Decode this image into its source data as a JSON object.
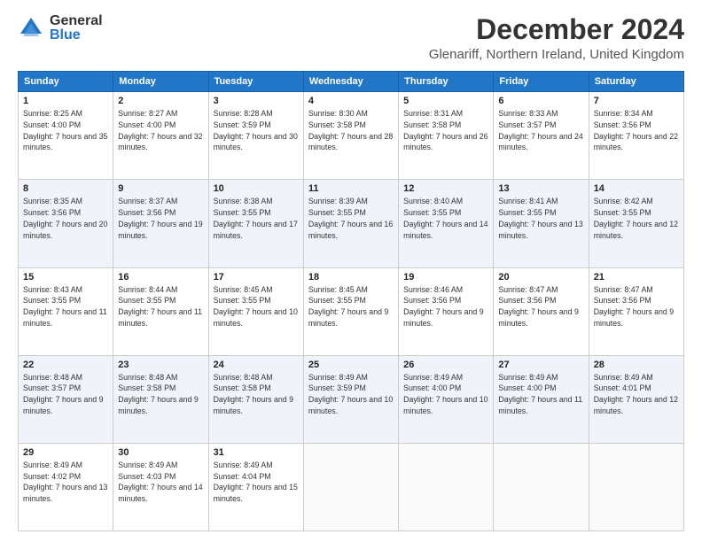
{
  "logo": {
    "general": "General",
    "blue": "Blue"
  },
  "title": "December 2024",
  "subtitle": "Glenariff, Northern Ireland, United Kingdom",
  "days_header": [
    "Sunday",
    "Monday",
    "Tuesday",
    "Wednesday",
    "Thursday",
    "Friday",
    "Saturday"
  ],
  "weeks": [
    [
      {
        "day": "1",
        "sunrise": "8:25 AM",
        "sunset": "4:00 PM",
        "daylight": "7 hours and 35 minutes."
      },
      {
        "day": "2",
        "sunrise": "8:27 AM",
        "sunset": "4:00 PM",
        "daylight": "7 hours and 32 minutes."
      },
      {
        "day": "3",
        "sunrise": "8:28 AM",
        "sunset": "3:59 PM",
        "daylight": "7 hours and 30 minutes."
      },
      {
        "day": "4",
        "sunrise": "8:30 AM",
        "sunset": "3:58 PM",
        "daylight": "7 hours and 28 minutes."
      },
      {
        "day": "5",
        "sunrise": "8:31 AM",
        "sunset": "3:58 PM",
        "daylight": "7 hours and 26 minutes."
      },
      {
        "day": "6",
        "sunrise": "8:33 AM",
        "sunset": "3:57 PM",
        "daylight": "7 hours and 24 minutes."
      },
      {
        "day": "7",
        "sunrise": "8:34 AM",
        "sunset": "3:56 PM",
        "daylight": "7 hours and 22 minutes."
      }
    ],
    [
      {
        "day": "8",
        "sunrise": "8:35 AM",
        "sunset": "3:56 PM",
        "daylight": "7 hours and 20 minutes."
      },
      {
        "day": "9",
        "sunrise": "8:37 AM",
        "sunset": "3:56 PM",
        "daylight": "7 hours and 19 minutes."
      },
      {
        "day": "10",
        "sunrise": "8:38 AM",
        "sunset": "3:55 PM",
        "daylight": "7 hours and 17 minutes."
      },
      {
        "day": "11",
        "sunrise": "8:39 AM",
        "sunset": "3:55 PM",
        "daylight": "7 hours and 16 minutes."
      },
      {
        "day": "12",
        "sunrise": "8:40 AM",
        "sunset": "3:55 PM",
        "daylight": "7 hours and 14 minutes."
      },
      {
        "day": "13",
        "sunrise": "8:41 AM",
        "sunset": "3:55 PM",
        "daylight": "7 hours and 13 minutes."
      },
      {
        "day": "14",
        "sunrise": "8:42 AM",
        "sunset": "3:55 PM",
        "daylight": "7 hours and 12 minutes."
      }
    ],
    [
      {
        "day": "15",
        "sunrise": "8:43 AM",
        "sunset": "3:55 PM",
        "daylight": "7 hours and 11 minutes."
      },
      {
        "day": "16",
        "sunrise": "8:44 AM",
        "sunset": "3:55 PM",
        "daylight": "7 hours and 11 minutes."
      },
      {
        "day": "17",
        "sunrise": "8:45 AM",
        "sunset": "3:55 PM",
        "daylight": "7 hours and 10 minutes."
      },
      {
        "day": "18",
        "sunrise": "8:45 AM",
        "sunset": "3:55 PM",
        "daylight": "7 hours and 9 minutes."
      },
      {
        "day": "19",
        "sunrise": "8:46 AM",
        "sunset": "3:56 PM",
        "daylight": "7 hours and 9 minutes."
      },
      {
        "day": "20",
        "sunrise": "8:47 AM",
        "sunset": "3:56 PM",
        "daylight": "7 hours and 9 minutes."
      },
      {
        "day": "21",
        "sunrise": "8:47 AM",
        "sunset": "3:56 PM",
        "daylight": "7 hours and 9 minutes."
      }
    ],
    [
      {
        "day": "22",
        "sunrise": "8:48 AM",
        "sunset": "3:57 PM",
        "daylight": "7 hours and 9 minutes."
      },
      {
        "day": "23",
        "sunrise": "8:48 AM",
        "sunset": "3:58 PM",
        "daylight": "7 hours and 9 minutes."
      },
      {
        "day": "24",
        "sunrise": "8:48 AM",
        "sunset": "3:58 PM",
        "daylight": "7 hours and 9 minutes."
      },
      {
        "day": "25",
        "sunrise": "8:49 AM",
        "sunset": "3:59 PM",
        "daylight": "7 hours and 10 minutes."
      },
      {
        "day": "26",
        "sunrise": "8:49 AM",
        "sunset": "4:00 PM",
        "daylight": "7 hours and 10 minutes."
      },
      {
        "day": "27",
        "sunrise": "8:49 AM",
        "sunset": "4:00 PM",
        "daylight": "7 hours and 11 minutes."
      },
      {
        "day": "28",
        "sunrise": "8:49 AM",
        "sunset": "4:01 PM",
        "daylight": "7 hours and 12 minutes."
      }
    ],
    [
      {
        "day": "29",
        "sunrise": "8:49 AM",
        "sunset": "4:02 PM",
        "daylight": "7 hours and 13 minutes."
      },
      {
        "day": "30",
        "sunrise": "8:49 AM",
        "sunset": "4:03 PM",
        "daylight": "7 hours and 14 minutes."
      },
      {
        "day": "31",
        "sunrise": "8:49 AM",
        "sunset": "4:04 PM",
        "daylight": "7 hours and 15 minutes."
      },
      null,
      null,
      null,
      null
    ]
  ]
}
